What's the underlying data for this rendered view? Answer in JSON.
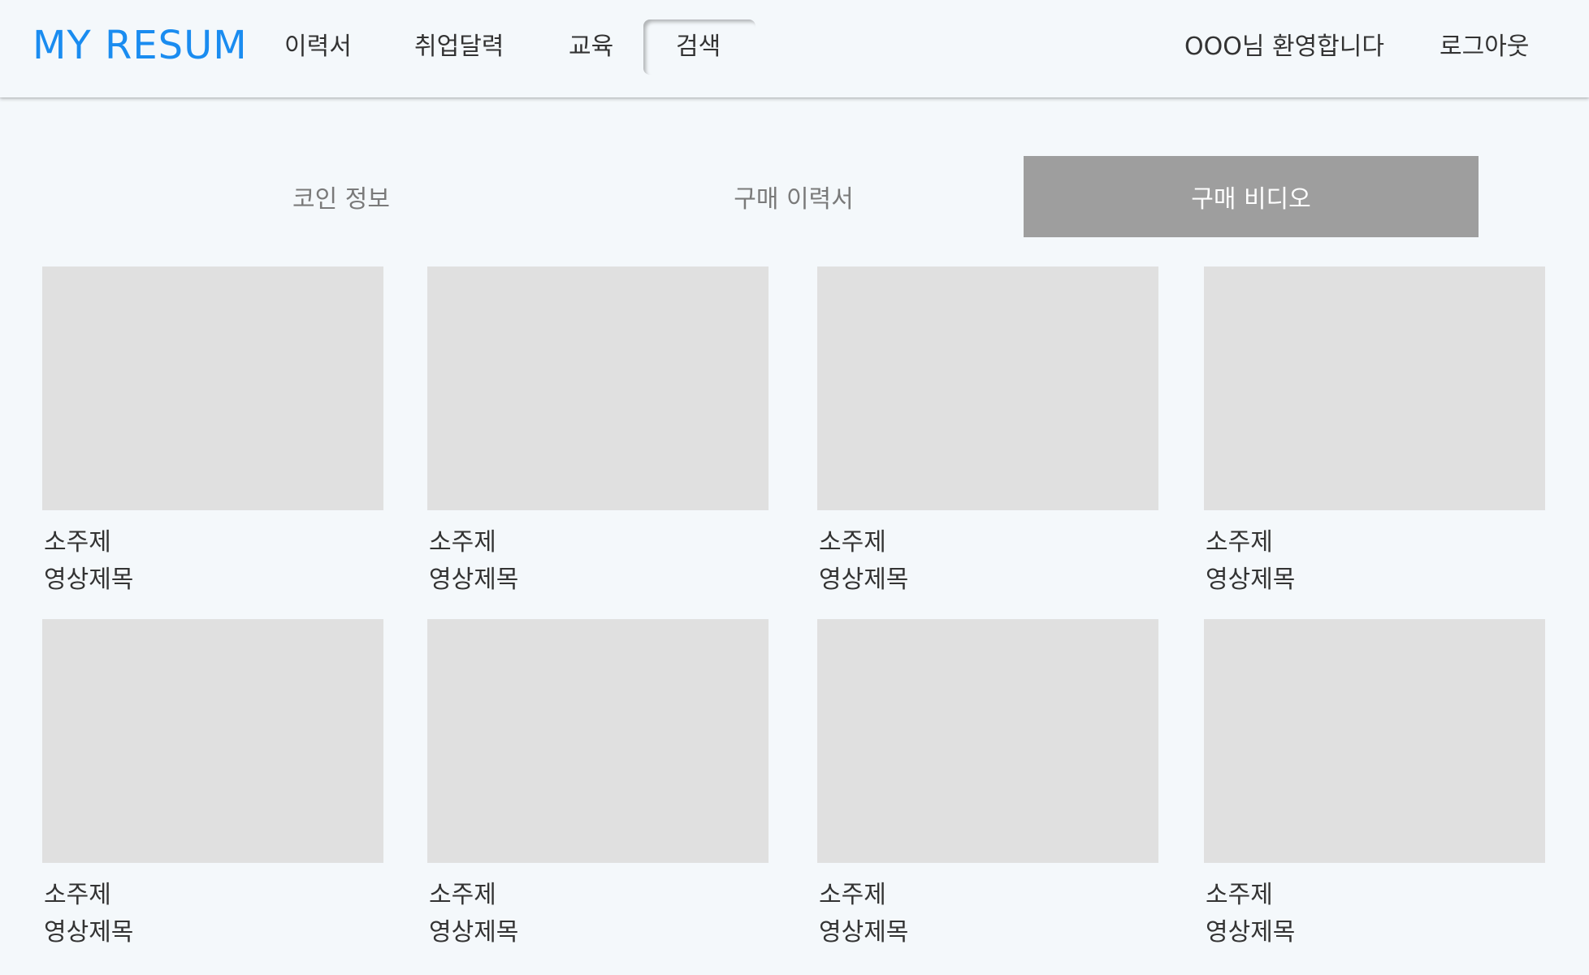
{
  "header": {
    "logo": "MY RESUM",
    "nav": {
      "resume": "이력서",
      "calendar": "취업달력",
      "education": "교육",
      "search": "검색"
    },
    "welcome": "OOO님 환영합니다",
    "logout": "로그아웃",
    "logo_color": "#1a8cf0"
  },
  "tabs": {
    "coin_info": "코인 정보",
    "purchased_resumes": "구매 이력서",
    "purchased_videos": "구매 비디오",
    "active": "purchased_videos",
    "active_bg": "#9e9e9e"
  },
  "videos": [
    {
      "topic": "소주제",
      "title": "영상제목"
    },
    {
      "topic": "소주제",
      "title": "영상제목"
    },
    {
      "topic": "소주제",
      "title": "영상제목"
    },
    {
      "topic": "소주제",
      "title": "영상제목"
    },
    {
      "topic": "소주제",
      "title": "영상제목"
    },
    {
      "topic": "소주제",
      "title": "영상제목"
    },
    {
      "topic": "소주제",
      "title": "영상제목"
    },
    {
      "topic": "소주제",
      "title": "영상제목"
    }
  ]
}
